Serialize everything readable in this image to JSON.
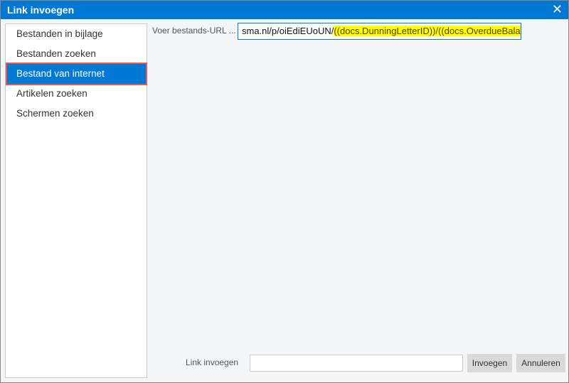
{
  "title": "Link invoegen",
  "close_icon": "close-icon",
  "sidebar": {
    "items": [
      {
        "label": "Bestanden in bijlage"
      },
      {
        "label": "Bestanden zoeken"
      },
      {
        "label": "Bestand van internet",
        "active": true
      },
      {
        "label": "Artikelen zoeken"
      },
      {
        "label": "Schermen zoeken"
      }
    ]
  },
  "url": {
    "label": "Voer bestands-URL ...",
    "value_plain": "sma.nl/p/oiEdiEUoUN/",
    "value_highlighted": "((docs.DunningLetterID))/((docs.OverdueBalance))"
  },
  "footer": {
    "link_label": "Link invoegen",
    "link_value": "",
    "insert_button": "Invoegen",
    "cancel_button": "Annuleren"
  },
  "colors": {
    "accent": "#0078d4",
    "highlight": "#ffff00",
    "selection_outline": "#e05a5a"
  }
}
